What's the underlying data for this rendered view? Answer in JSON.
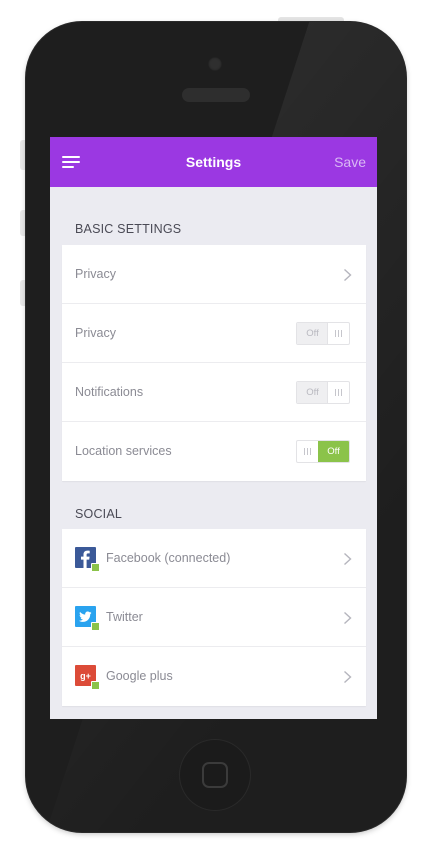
{
  "header": {
    "title": "Settings",
    "save_label": "Save"
  },
  "sections": {
    "basic": {
      "heading": "BASIC SETTINGS",
      "rows": [
        {
          "label": "Privacy",
          "control": "chevron-right-icon"
        },
        {
          "label": "Privacy",
          "control": "toggle",
          "toggle_text": "Off",
          "state": "off"
        },
        {
          "label": "Notifications",
          "control": "toggle",
          "toggle_text": "Off",
          "state": "off"
        },
        {
          "label": "Location services",
          "control": "toggle",
          "toggle_text": "Off",
          "state": "on-green"
        }
      ]
    },
    "social": {
      "heading": "SOCIAL",
      "rows": [
        {
          "label": "Facebook (connected)",
          "icon": "facebook-icon",
          "connected": true
        },
        {
          "label": "Twitter",
          "icon": "twitter-icon",
          "connected": true
        },
        {
          "label": "Google plus",
          "icon": "google-plus-icon",
          "connected": true
        }
      ]
    }
  },
  "colors": {
    "header": "#9b38e2",
    "screen_background": "#ebebf1",
    "toggle_green": "#8bc34a",
    "facebook": "#3b5998",
    "twitter": "#2aa3ef",
    "google_plus": "#dc4b38",
    "phone_body": "#1e1e1e"
  }
}
